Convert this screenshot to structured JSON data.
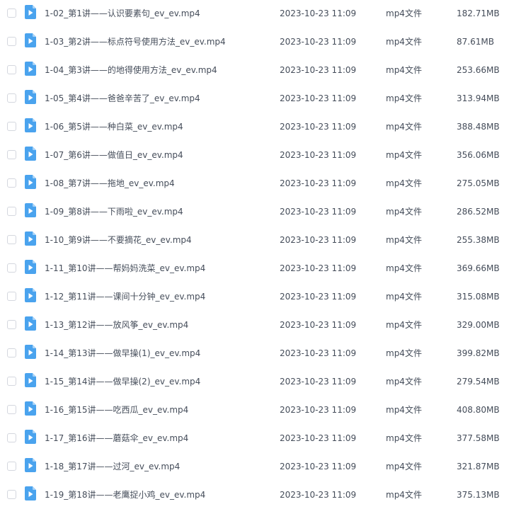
{
  "files": [
    {
      "name": "1-02_第1讲——认识要素句_ev_ev.mp4",
      "modified": "2023-10-23 11:09",
      "type": "mp4文件",
      "size": "182.71MB"
    },
    {
      "name": "1-03_第2讲——标点符号使用方法_ev_ev.mp4",
      "modified": "2023-10-23 11:09",
      "type": "mp4文件",
      "size": "87.61MB"
    },
    {
      "name": "1-04_第3讲——的地得使用方法_ev_ev.mp4",
      "modified": "2023-10-23 11:09",
      "type": "mp4文件",
      "size": "253.66MB"
    },
    {
      "name": "1-05_第4讲——爸爸辛苦了_ev_ev.mp4",
      "modified": "2023-10-23 11:09",
      "type": "mp4文件",
      "size": "313.94MB"
    },
    {
      "name": "1-06_第5讲——种白菜_ev_ev.mp4",
      "modified": "2023-10-23 11:09",
      "type": "mp4文件",
      "size": "388.48MB"
    },
    {
      "name": "1-07_第6讲——做值日_ev_ev.mp4",
      "modified": "2023-10-23 11:09",
      "type": "mp4文件",
      "size": "356.06MB"
    },
    {
      "name": "1-08_第7讲——拖地_ev_ev.mp4",
      "modified": "2023-10-23 11:09",
      "type": "mp4文件",
      "size": "275.05MB"
    },
    {
      "name": "1-09_第8讲——下雨啦_ev_ev.mp4",
      "modified": "2023-10-23 11:09",
      "type": "mp4文件",
      "size": "286.52MB"
    },
    {
      "name": "1-10_第9讲——不要摘花_ev_ev.mp4",
      "modified": "2023-10-23 11:09",
      "type": "mp4文件",
      "size": "255.38MB"
    },
    {
      "name": "1-11_第10讲——帮妈妈洗菜_ev_ev.mp4",
      "modified": "2023-10-23 11:09",
      "type": "mp4文件",
      "size": "369.66MB"
    },
    {
      "name": "1-12_第11讲——课间十分钟_ev_ev.mp4",
      "modified": "2023-10-23 11:09",
      "type": "mp4文件",
      "size": "315.08MB"
    },
    {
      "name": "1-13_第12讲——放风筝_ev_ev.mp4",
      "modified": "2023-10-23 11:09",
      "type": "mp4文件",
      "size": "329.00MB"
    },
    {
      "name": "1-14_第13讲——做早操(1)_ev_ev.mp4",
      "modified": "2023-10-23 11:09",
      "type": "mp4文件",
      "size": "399.82MB"
    },
    {
      "name": "1-15_第14讲——做早操(2)_ev_ev.mp4",
      "modified": "2023-10-23 11:09",
      "type": "mp4文件",
      "size": "279.54MB"
    },
    {
      "name": "1-16_第15讲——吃西瓜_ev_ev.mp4",
      "modified": "2023-10-23 11:09",
      "type": "mp4文件",
      "size": "408.80MB"
    },
    {
      "name": "1-17_第16讲——蘑菇伞_ev_ev.mp4",
      "modified": "2023-10-23 11:09",
      "type": "mp4文件",
      "size": "377.58MB"
    },
    {
      "name": "1-18_第17讲——过河_ev_ev.mp4",
      "modified": "2023-10-23 11:09",
      "type": "mp4文件",
      "size": "321.87MB"
    },
    {
      "name": "1-19_第18讲——老鹰捉小鸡_ev_ev.mp4",
      "modified": "2023-10-23 11:09",
      "type": "mp4文件",
      "size": "375.13MB"
    }
  ],
  "icons": {
    "file_icon": "video-file-icon",
    "checkbox": "checkbox-icon"
  },
  "colors": {
    "icon_blue": "#4aa3ee",
    "icon_fold": "#a8d3f8",
    "text": "#454d5a",
    "checkbox_border": "#d4d7de"
  }
}
